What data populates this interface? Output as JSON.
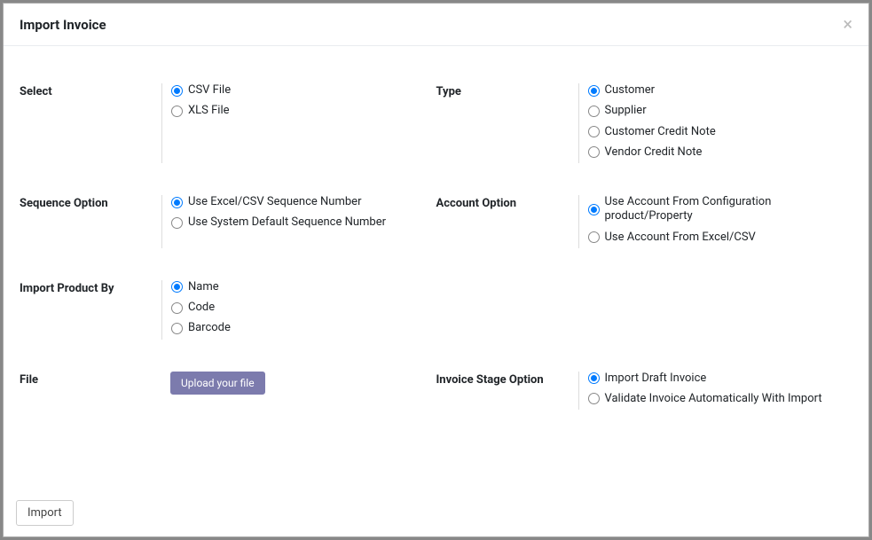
{
  "modal": {
    "title": "Import Invoice",
    "close": "×"
  },
  "select": {
    "label": "Select",
    "options": {
      "csv": "CSV File",
      "xls": "XLS File"
    }
  },
  "type": {
    "label": "Type",
    "options": {
      "customer": "Customer",
      "supplier": "Supplier",
      "ccn": "Customer Credit Note",
      "vcn": "Vendor Credit Note"
    }
  },
  "sequence": {
    "label": "Sequence Option",
    "options": {
      "excel": "Use Excel/CSV Sequence Number",
      "system": "Use System Default Sequence Number"
    }
  },
  "account": {
    "label": "Account Option",
    "options": {
      "config": "Use Account From Configuration product/Property",
      "excel": "Use Account From Excel/CSV"
    }
  },
  "productby": {
    "label": "Import Product By",
    "options": {
      "name": "Name",
      "code": "Code",
      "barcode": "Barcode"
    }
  },
  "file": {
    "label": "File",
    "upload": "Upload your file"
  },
  "stage": {
    "label": "Invoice Stage Option",
    "options": {
      "draft": "Import Draft Invoice",
      "validate": "Validate Invoice Automatically With Import"
    }
  },
  "footer": {
    "import": "Import"
  }
}
